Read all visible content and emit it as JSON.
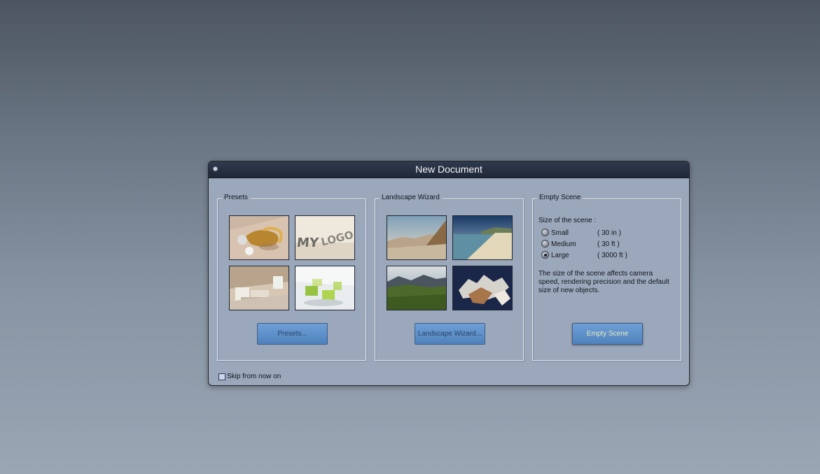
{
  "dialog": {
    "title": "New Document",
    "presets": {
      "label": "Presets",
      "button": "Presets..."
    },
    "landscape": {
      "label": "Landscape Wizard",
      "button": "Landscape Wizard..."
    },
    "empty": {
      "label": "Empty Scene",
      "size_label": "Size of the scene :",
      "options": [
        {
          "name": "Small",
          "size": "( 30 in )",
          "checked": false
        },
        {
          "name": "Medium",
          "size": "( 30 ft )",
          "checked": false
        },
        {
          "name": "Large",
          "size": "( 3000 ft )",
          "checked": true
        }
      ],
      "description": "The size of the scene affects camera speed, rendering precision and the default size of new objects.",
      "button": "Empty Scene"
    },
    "skip_label": "Skip from now on",
    "skip_checked": false
  }
}
